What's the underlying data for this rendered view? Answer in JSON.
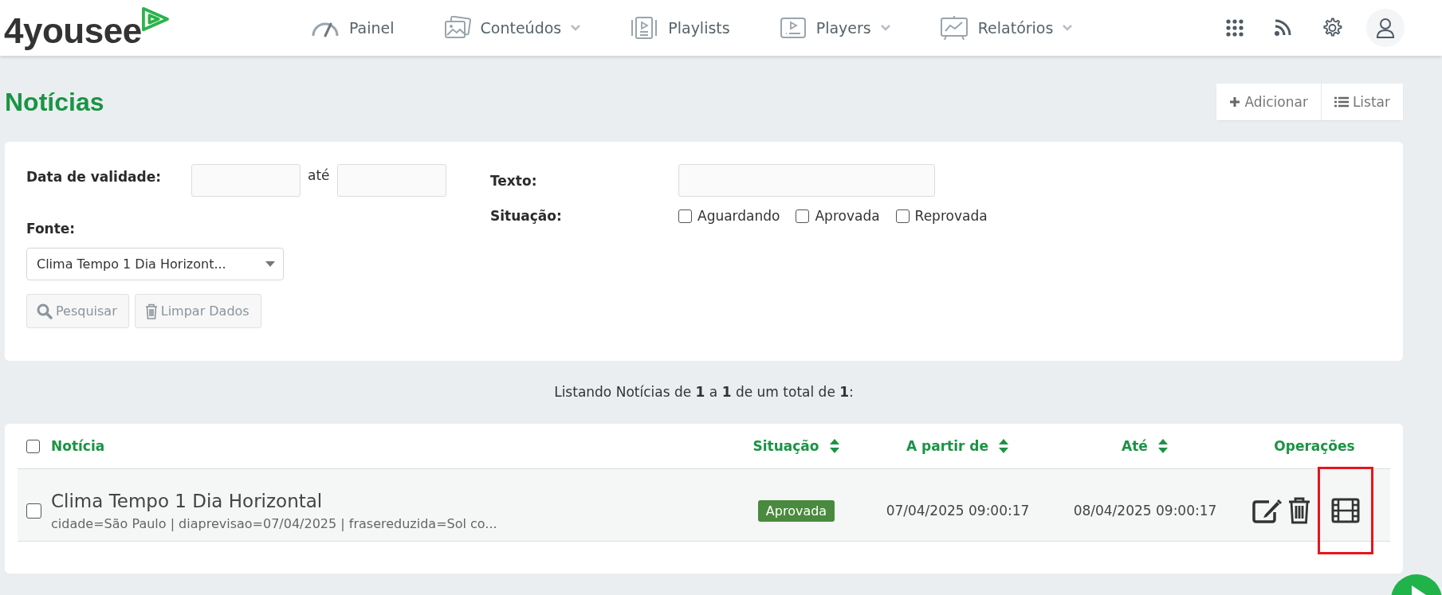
{
  "header": {
    "logo": "4yousee",
    "nav": [
      {
        "label": "Painel",
        "has_menu": false
      },
      {
        "label": "Conteúdos",
        "has_menu": true
      },
      {
        "label": "Playlists",
        "has_menu": false
      },
      {
        "label": "Players",
        "has_menu": true
      },
      {
        "label": "Relatórios",
        "has_menu": true
      }
    ]
  },
  "page": {
    "title": "Notícias",
    "buttons": [
      {
        "label": "Adicionar",
        "kind": "plus"
      },
      {
        "label": "Listar",
        "kind": "list"
      }
    ]
  },
  "filters": {
    "validity_label": "Data de validade:",
    "until_label": "até",
    "text_label": "Texto:",
    "source_label": "Fonte:",
    "status_label": "Situação:",
    "statuses": [
      {
        "label": "Aguardando",
        "checked": false
      },
      {
        "label": "Aprovada",
        "checked": false
      },
      {
        "label": "Reprovada",
        "checked": false
      }
    ],
    "source_value": "Clima Tempo 1 Dia Horizont...",
    "buttons": [
      {
        "label": "Pesquisar",
        "kind": "search"
      },
      {
        "label": "Limpar Dados",
        "kind": "trash"
      }
    ]
  },
  "summary": "Listando Notícias de **1** a **1** de um total de **1**:",
  "table": {
    "select_all_checked": false,
    "columns": [
      {
        "label": "Notícia",
        "sortable": false
      },
      {
        "label": "Situação",
        "sortable": true
      },
      {
        "label": "A partir de",
        "sortable": true
      },
      {
        "label": "Até",
        "sortable": true
      },
      {
        "label": "Operações",
        "sortable": false
      }
    ],
    "rows": [
      {
        "checked": false,
        "title": "Clima Tempo 1 Dia Horizontal",
        "details": "cidade=São Paulo | diaprevisao=07/04/2025 | frasereduzida=Sol co...",
        "status": "Aprovada",
        "from": "07/04/2025 09:00:17",
        "until": "08/04/2025 09:00:17",
        "operations": [
          {
            "kind": "edit",
            "highlighted": false
          },
          {
            "kind": "delete",
            "highlighted": false
          },
          {
            "kind": "preview",
            "highlighted": true
          }
        ]
      }
    ]
  }
}
